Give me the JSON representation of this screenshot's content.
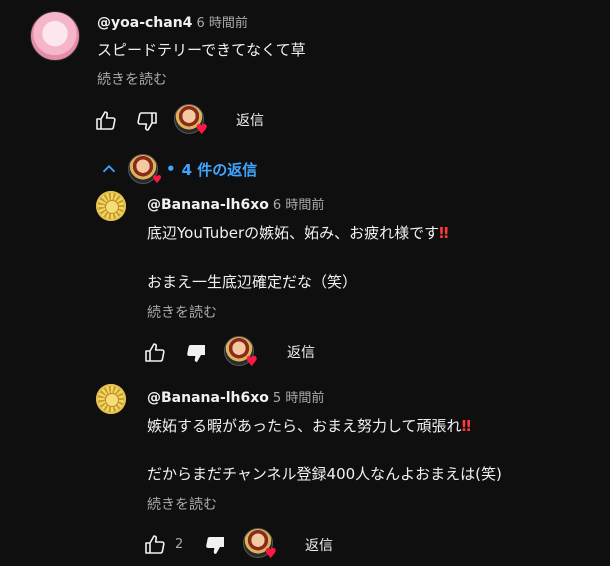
{
  "top_comment": {
    "handle": "@yoa-chan4",
    "time": "6 時間前",
    "text": "スピードテリーできてなくて草",
    "read_more": "続きを読む",
    "reply_label": "返信"
  },
  "replies_toggle": {
    "dot": "•",
    "label": "4 件の返信"
  },
  "replies": [
    {
      "handle": "@Banana-lh6xo",
      "time": "6 時間前",
      "line1": "底辺YouTuberの嫉妬、妬み、お疲れ様です",
      "line1_emoji": "‼",
      "line2": "おまえ一生底辺確定だな（笑）",
      "read_more": "続きを読む",
      "reply_label": "返信",
      "likes": ""
    },
    {
      "handle": "@Banana-lh6xo",
      "time": "5 時間前",
      "line1": "嫉妬する暇があったら、おまえ努力して頑張れ",
      "line1_emoji": "‼",
      "line2": "だからまだチャンネル登録400人なんよおまえは(笑)",
      "read_more": "続きを読む",
      "reply_label": "返信",
      "likes": "2"
    }
  ],
  "icons": {
    "like": "thumbs-up-icon",
    "dislike": "thumbs-down-icon",
    "heart": "heart-icon",
    "chevron": "chevron-up-icon"
  },
  "colors": {
    "background": "#0f0f0f",
    "link_blue": "#3ea6ff",
    "heart_red": "#ff1744",
    "muted": "#aaaaaa"
  }
}
